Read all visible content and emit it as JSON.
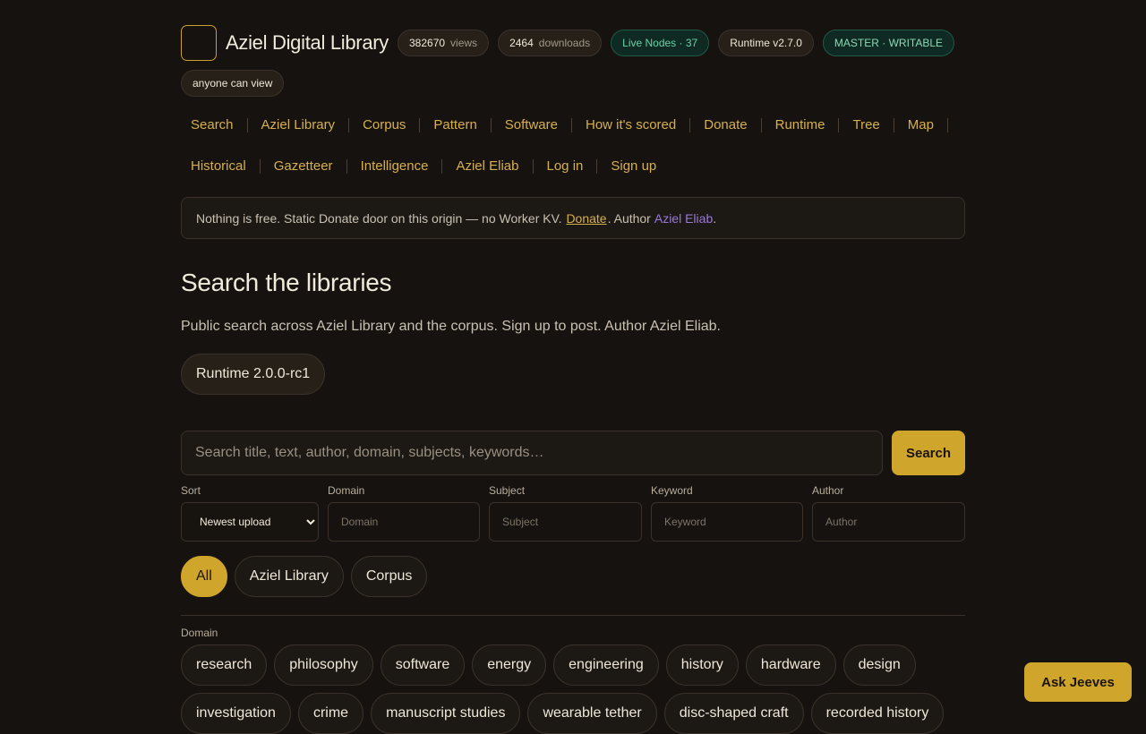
{
  "header": {
    "brand": "Aziel Digital Library",
    "views_count": "382670",
    "views_label": "views",
    "downloads_count": "2464",
    "downloads_label": "downloads",
    "live_nodes": "Live Nodes · 37",
    "runtime": "Runtime v2.7.0",
    "mode": "MASTER · WRITABLE",
    "visibility": "anyone can view"
  },
  "nav": {
    "row1": [
      "Search",
      "Aziel Library",
      "Corpus",
      "Pattern",
      "Software",
      "How it's scored",
      "Donate",
      "Runtime",
      "Tree",
      "Map"
    ],
    "row2": [
      "Historical",
      "Gazetteer",
      "Intelligence",
      "Aziel Eliab",
      "Log in",
      "Sign up"
    ]
  },
  "notice": {
    "text": "Nothing is free. Static Donate door on this origin — no Worker KV.",
    "donate_link": "Donate",
    "author_prefix": ". Author",
    "author_link": "Aziel Eliab",
    "end": "."
  },
  "main": {
    "title": "Search the libraries",
    "lede": "Public search across Aziel Library and the corpus. Sign up to post. Author Aziel Eliab.",
    "runtime_chip": "Runtime 2.0.0-rc1"
  },
  "search": {
    "placeholder": "Search title, text, author, domain, subjects, keywords…",
    "button": "Search"
  },
  "filters": {
    "sort_label": "Sort",
    "sort_value": "Newest upload",
    "domain_label": "Domain",
    "domain_placeholder": "Domain",
    "subject_label": "Subject",
    "subject_placeholder": "Subject",
    "keyword_label": "Keyword",
    "keyword_placeholder": "Keyword",
    "author_label": "Author",
    "author_placeholder": "Author"
  },
  "scope": [
    "All",
    "Aziel Library",
    "Corpus"
  ],
  "domains": {
    "label": "Domain",
    "tags": [
      "research",
      "philosophy",
      "software",
      "energy",
      "engineering",
      "history",
      "hardware",
      "design",
      "investigation",
      "crime",
      "manuscript studies",
      "wearable tether",
      "disc-shaped craft",
      "recorded history"
    ]
  },
  "assistant": {
    "button": "Ask Jeeves"
  },
  "colors": {
    "accent": "#d0a52c",
    "background": "#15120f",
    "green": "#64d3a6",
    "author_link": "#9a78d6"
  }
}
